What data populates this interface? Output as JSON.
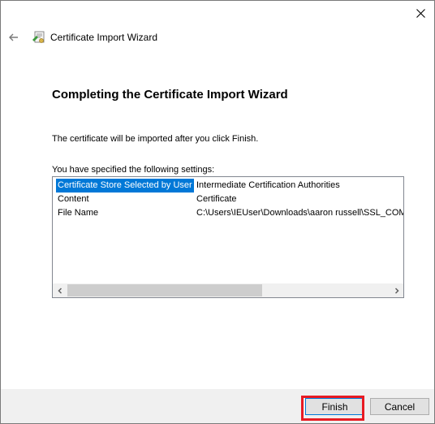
{
  "window": {
    "title": "Certificate Import Wizard"
  },
  "page": {
    "heading": "Completing the Certificate Import Wizard",
    "description": "The certificate will be imported after you click Finish.",
    "settings_label": "You have specified the following settings:"
  },
  "settings": [
    {
      "name": "Certificate Store Selected by User",
      "value": "Intermediate Certification Authorities",
      "selected": true
    },
    {
      "name": "Content",
      "value": "Certificate",
      "selected": false
    },
    {
      "name": "File Name",
      "value": "C:\\Users\\IEUser\\Downloads\\aaron russell\\SSL_COM_",
      "selected": false
    }
  ],
  "buttons": {
    "finish": "Finish",
    "cancel": "Cancel"
  },
  "colors": {
    "selection": "#0078d7",
    "highlight_box": "#e81b23"
  },
  "icons": {
    "close": "close-icon",
    "back": "back-arrow-icon",
    "wizard": "certificate-wizard-icon",
    "scroll_left": "chevron-left-icon",
    "scroll_right": "chevron-right-icon"
  }
}
